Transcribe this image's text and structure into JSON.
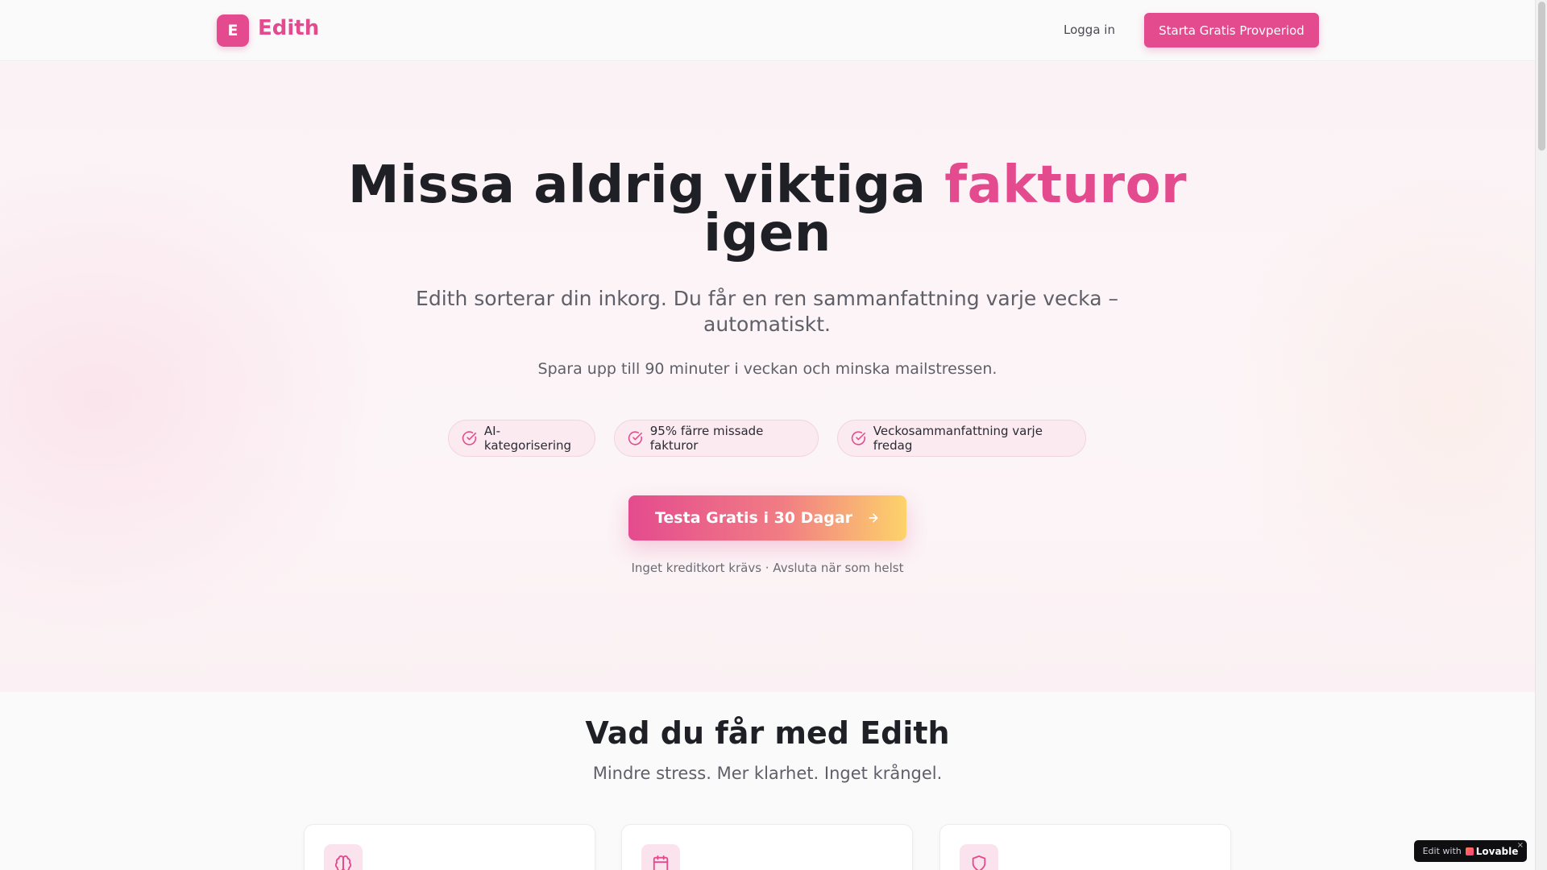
{
  "header": {
    "logo_letter": "E",
    "brand": "Edith",
    "login_label": "Logga in",
    "cta_label": "Starta Gratis Provperiod"
  },
  "hero": {
    "title_part1": "Missa aldrig viktiga ",
    "title_accent": "fakturor",
    "title_part2": "igen",
    "subtitle": "Edith sorterar din inkorg. Du får en ren sammanfattning varje vecka – automatiskt.",
    "note": "Spara upp till 90 minuter i veckan och minska mailstressen.",
    "pills": [
      {
        "label": "AI-kategorisering",
        "icon": "check-circle-icon"
      },
      {
        "label": "95% färre missade fakturor",
        "icon": "check-circle-icon"
      },
      {
        "label": "Veckosammanfattning varje fredag",
        "icon": "check-circle-icon"
      }
    ],
    "cta_label": "Testa Gratis i 30 Dagar",
    "cta_foot": "Inget kreditkort krävs · Avsluta när som helst"
  },
  "features": {
    "title": "Vad du får med Edith",
    "subtitle": "Mindre stress. Mer klarhet. Inget krångel.",
    "cards": [
      {
        "icon": "brain-icon"
      },
      {
        "icon": "calendar-icon"
      },
      {
        "icon": "shield-icon"
      }
    ]
  },
  "badge": {
    "prefix": "Edit with",
    "brand": "Lovable",
    "close": "×"
  },
  "colors": {
    "accent": "#e44b8e",
    "cta_gradient_end": "#fdd36a",
    "text_dark": "#1f2026",
    "text_muted": "#5f5f68"
  }
}
